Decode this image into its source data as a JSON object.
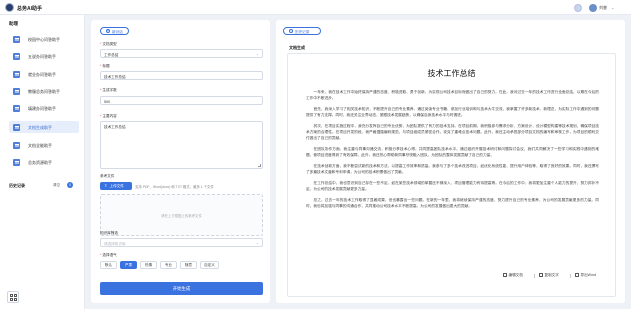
{
  "header": {
    "app_title": "总务AI助手",
    "user_name": "刘睿",
    "chevron": "⌄"
  },
  "sidebar": {
    "heading": "助理",
    "items": [
      {
        "label": "校园中心问答助手",
        "active": false
      },
      {
        "label": "五说办问答助手",
        "active": false
      },
      {
        "label": "就业办问答助手",
        "active": false
      },
      {
        "label": "教服总务问答助手",
        "active": false
      },
      {
        "label": "填建办问答助手",
        "active": false
      },
      {
        "label": "文档生成助手",
        "active": true
      },
      {
        "label": "文档全能助手",
        "active": false
      },
      {
        "label": "总务资源助手",
        "active": false
      }
    ],
    "history_title": "历史记录",
    "history_clear": "清空",
    "history_count": "0"
  },
  "form": {
    "new_button": "新对话",
    "doc_type_label": "文档类型",
    "doc_type_value": "工作总结",
    "title_label": "标题",
    "title_value": "技术工作总结",
    "word_count_label": "生成字数",
    "word_count_value": "500",
    "content_label": "主要内容",
    "content_value": "技术工作总结",
    "ref_label": "参考文件",
    "upload_button": "上传文件",
    "upload_hint": "支持 PDF、Word(docx) 和 TXT 格式，最多 1 个文件",
    "dropzone_text": "请在上方框图上传参考文件",
    "kb_label": "知识库筛选",
    "kb_placeholder": "请选择知识库",
    "tone_label": "选择语气",
    "tones": [
      {
        "label": "默认",
        "active": false
      },
      {
        "label": "严肃",
        "active": true
      },
      {
        "label": "热情",
        "active": false
      },
      {
        "label": "专业",
        "active": false
      },
      {
        "label": "随意",
        "active": false
      },
      {
        "label": "自定义",
        "active": false
      }
    ],
    "generate_button": "开始生成"
  },
  "output": {
    "history_button": "历史记录",
    "heading": "文档生成",
    "doc_title": "技术工作总结",
    "paragraphs": [
      "一年来，我在技术工作中始终保持严谨的态度、积极进取、勇于创新，为实现公司技术目标而做出了自己的努力。在此，我对过去一年的技术工作进行全面总结，以期在今后的工作中不断进步。",
      "首先，我深入学习了相关技术知识，不断提升自己的专业素养，通过阅读专业书籍、参加行业培训和与技术大牛交流，我掌握了许多新技术、新理念，为实际工作中遇到的问题提供了有力支撑。同时，我还关注业界动态，紧跟技术发展趋势，以确保自身技术水平与时俱进。",
      "其次，在项目实施过程中，我充分发挥自己的专业优势，为团队提供了有力的技术支持。在项目前期，我积极参与需求分析、方案设计、设计模型构建等技术规划，确保项目技术方案的合理性。在项目开发阶段，我严格遵循编码规范，与项目组成员紧密合作，攻克了重难点技术问题。此外，我还主动承担部分项目文档的编写和审核工作，为项目的顺利交付做出了自己的贡献。",
      "在团队协作方面，我注重与同事沟通交流，积极分享技术心得，共同提高团队技术水平。通过组织开展技术研讨和问题探讨会议，我们共同解决了一些学习和实践中遇到的难题，使项目进度得到了有效保障。此外，我还热心帮助新同事尽快融入团队，为团队的整体发展贡献了自己的力量。",
      "在技术创新方面，我不断尝试新的技术和方法，以提高工作效率和质量。我参与了多个技术改进项目，如优化系统性能、提升用户体验等，取得了良好的效果。同时，我还撰写了多篇技术文章和专利申请，为公司的技术积累做出了贡献。",
      "在工作总结中，我也意识到自己存在一些不足，如在某些技术领域的掌握还不够深入、项目管理能力有待提高等。在今后的工作中，我将更加注重个人能力的提升，努力弥补不足，为公司的技术发展贡献更多力量。",
      "总之，过去一年的技术工作取得了显著成果，但也暴露出一些问题。在新的一年里，我将继续保持严谨的态度，努力提升自己的专业素养，为公司的发展贡献更多的力量。同时，我也将加强与同事的沟通合作，共同推动公司技术水平不断提高，为公司的发展做出更大的贡献。"
    ],
    "actions": [
      "编辑文档",
      "复制文字",
      "导出Word"
    ]
  }
}
